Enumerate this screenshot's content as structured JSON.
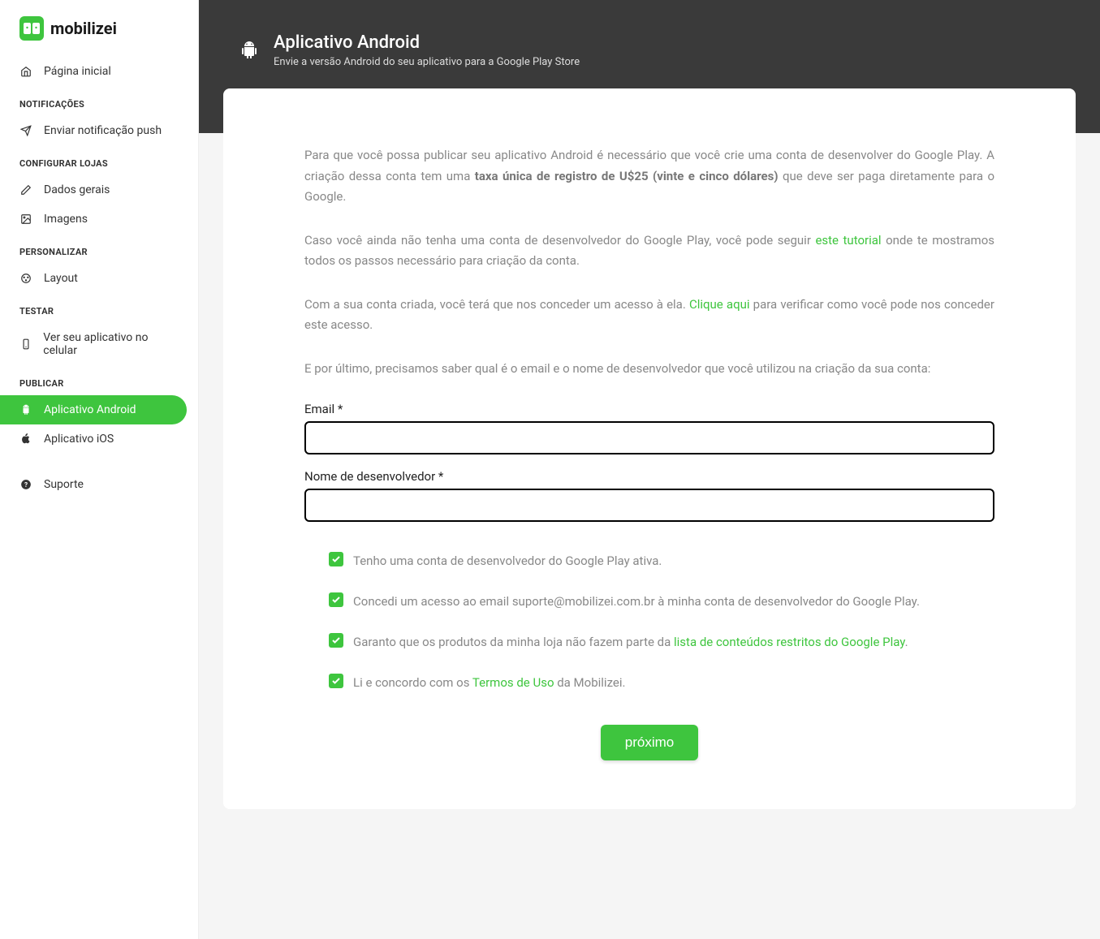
{
  "brand": "mobilizei",
  "sidebar": {
    "home": "Página inicial",
    "sections": {
      "notificacoes": {
        "title": "NOTIFICAÇÕES",
        "items": [
          "Enviar notificação push"
        ]
      },
      "configurar": {
        "title": "CONFIGURAR LOJAS",
        "items": [
          "Dados gerais",
          "Imagens"
        ]
      },
      "personalizar": {
        "title": "PERSONALIZAR",
        "items": [
          "Layout"
        ]
      },
      "testar": {
        "title": "TESTAR",
        "items": [
          "Ver seu aplicativo no celular"
        ]
      },
      "publicar": {
        "title": "PUBLICAR",
        "items": [
          "Aplicativo Android",
          "Aplicativo iOS"
        ]
      }
    },
    "suporte": "Suporte"
  },
  "header": {
    "title": "Aplicativo Android",
    "subtitle": "Envie a versão Android do seu aplicativo para a Google Play Store"
  },
  "content": {
    "p1_a": "Para que você possa publicar seu aplicativo Android é necessário que você crie uma conta de desenvolver do Google Play. A criação dessa conta tem uma ",
    "p1_b": "taxa única de registro de U$25 (vinte e cinco dólares)",
    "p1_c": " que deve ser paga diretamente para o Google.",
    "p2_a": "Caso você ainda não tenha uma conta de desenvolvedor do Google Play, você pode seguir ",
    "p2_link": "este tutorial",
    "p2_b": " onde te mostramos todos os passos necessário para criação da conta.",
    "p3_a": "Com a sua conta criada, você terá que nos conceder um acesso à ela. ",
    "p3_link": "Clique aqui",
    "p3_b": " para verificar como você pode nos conceder este acesso.",
    "p4": "E por último, precisamos saber qual é o email e o nome de desenvolvedor que você utilizou na criação da sua conta:"
  },
  "form": {
    "email_label": "Email *",
    "devname_label": "Nome de desenvolvedor *",
    "email_value": "",
    "devname_value": ""
  },
  "checks": {
    "c1": "Tenho uma conta de desenvolvedor do Google Play ativa.",
    "c2": "Concedi um acesso ao email suporte@mobilizei.com.br à minha conta de desenvolvedor do Google Play.",
    "c3_a": "Garanto que os produtos da minha loja não fazem parte da ",
    "c3_link": "lista de conteúdos restritos do Google Play",
    "c3_b": ".",
    "c4_a": "Li e concordo com os ",
    "c4_link": "Termos de Uso",
    "c4_b": " da Mobilizei."
  },
  "button": {
    "next": "próximo"
  }
}
